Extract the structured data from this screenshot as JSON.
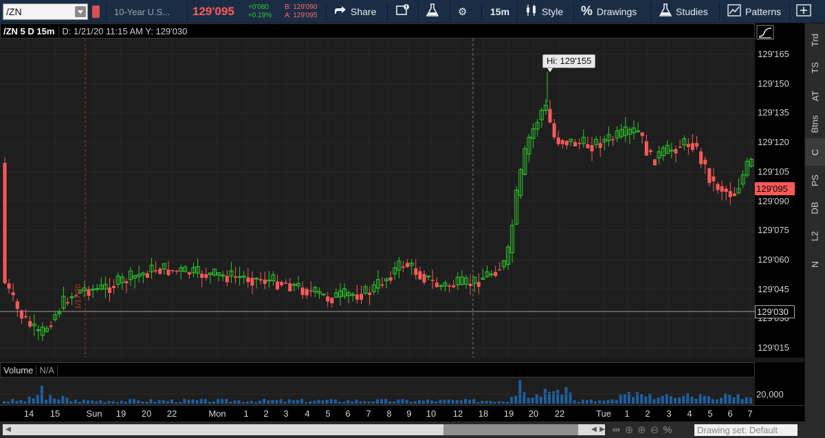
{
  "toolbar": {
    "symbol": "/ZN",
    "description": "10-Year U.S...",
    "last_price": "129'095",
    "net_change": "+0'080",
    "pct_change": "+0.19%",
    "bid": "B: 129'090",
    "ask": "A: 129'095",
    "share_label": "Share",
    "timeframe_label": "15m",
    "style_label": "Style",
    "drawings_label": "Drawings",
    "studies_label": "Studies",
    "patterns_label": "Patterns"
  },
  "header": {
    "symbol_period": "/ZN 5 D 15m",
    "info": "D: 1/21/20 11:15 AM  Y: 129'030"
  },
  "price_axis": {
    "ticks": [
      "129'165",
      "129'150",
      "129'135",
      "129'120",
      "129'105",
      "129'090",
      "129'075",
      "129'060",
      "129'045",
      "129'030",
      "129'015"
    ],
    "current_price": "129'095",
    "crosshair_price": "129'030"
  },
  "annotations": {
    "high_label": "Hi: 129'155",
    "date_marker": "1/17/20"
  },
  "side_tabs": [
    "Trd",
    "TS",
    "AT",
    "Btns",
    "C",
    "PS",
    "DB",
    "L2",
    "N"
  ],
  "volume": {
    "label": "Volume",
    "value": "N/A",
    "tick": "20,000"
  },
  "x_axis": {
    "labels": [
      "14",
      "15",
      "Sun",
      "19",
      "20",
      "22",
      "Mon",
      "1",
      "2",
      "3",
      "4",
      "5",
      "6",
      "7",
      "8",
      "9",
      "10",
      "12",
      "18",
      "19",
      "20",
      "22",
      "Tue",
      "1",
      "2",
      "3",
      "4",
      "5",
      "6",
      "7"
    ]
  },
  "scrollbar": {
    "drawing_set": "Drawing set: Default"
  },
  "colors": {
    "up": "#2ecc2e",
    "down": "#ff5a5a",
    "toolbar_bg": "#1b2d44",
    "volume": "#1f5fa0"
  },
  "chart_data": {
    "type": "candlestick",
    "timeframe": "15m",
    "ylim": [
      "129'015",
      "129'165"
    ],
    "high": "129'155",
    "last": "129'095"
  }
}
